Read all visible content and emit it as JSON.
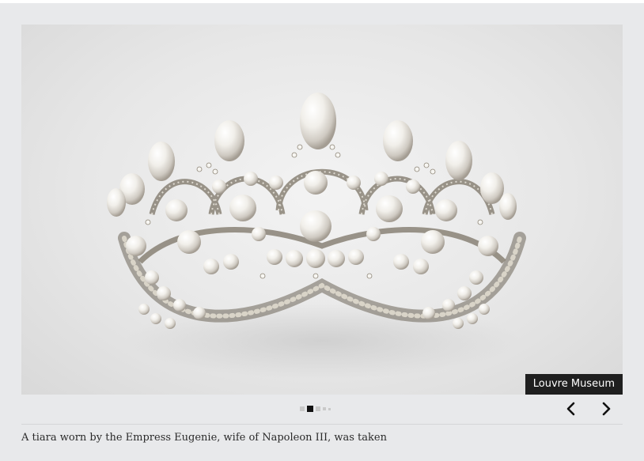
{
  "gallery": {
    "credit": "Louvre Museum",
    "caption": "A tiara worn by the Empress Eugenie, wife of Napoleon III, was taken",
    "image_alt": "Pearl and diamond tiara",
    "pagination": {
      "total": 5,
      "current": 2
    },
    "prev_icon": "chevron-left-icon",
    "next_icon": "chevron-right-icon"
  }
}
